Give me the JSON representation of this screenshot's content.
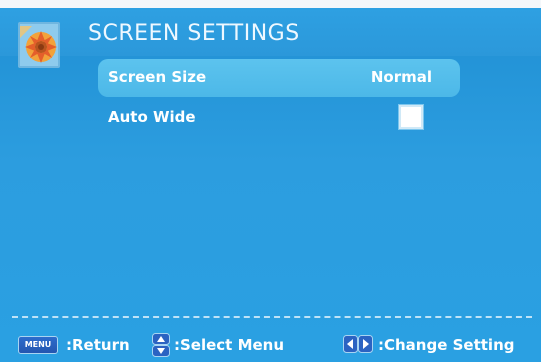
{
  "header": {
    "title": "SCREEN SETTINGS",
    "logo_icon": "sun-flower-logo-icon"
  },
  "menu": {
    "items": [
      {
        "label": "Screen Size",
        "value": "Normal",
        "selected": true
      },
      {
        "label": "Auto Wide",
        "checked": false
      }
    ]
  },
  "footer": {
    "menu_key": "MENU",
    "return_label": ":Return",
    "select_label": ":Select Menu",
    "change_label": ":Change Setting"
  },
  "colors": {
    "background": "#2aa0e2",
    "selected_row": "#52bcea",
    "header": "#2ea0e2"
  }
}
